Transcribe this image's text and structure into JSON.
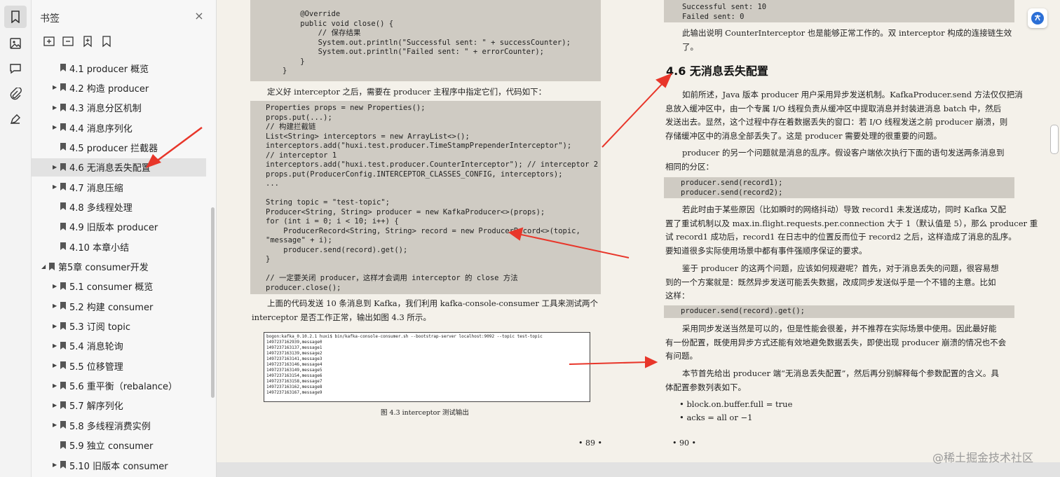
{
  "panel": {
    "title": "书签",
    "close": "×",
    "items": [
      {
        "label": "4.1 producer 概览",
        "level": 2,
        "caret": false
      },
      {
        "label": "4.2 构造 producer",
        "level": 2,
        "caret": true
      },
      {
        "label": "4.3 消息分区机制",
        "level": 2,
        "caret": true
      },
      {
        "label": "4.4 消息序列化",
        "level": 2,
        "caret": true
      },
      {
        "label": "4.5 producer 拦截器",
        "level": 2,
        "caret": false
      },
      {
        "label": "4.6 无消息丢失配置",
        "level": 2,
        "caret": true,
        "selected": true
      },
      {
        "label": "4.7 消息压缩",
        "level": 2,
        "caret": true
      },
      {
        "label": "4.8 多线程处理",
        "level": 2,
        "caret": false
      },
      {
        "label": "4.9 旧版本 producer",
        "level": 2,
        "caret": false
      },
      {
        "label": "4.10 本章小结",
        "level": 2,
        "caret": false
      },
      {
        "label": "第5章   consumer开发",
        "level": 1,
        "caret": true,
        "expanded": true
      },
      {
        "label": "5.1 consumer 概览",
        "level": 2,
        "caret": true
      },
      {
        "label": "5.2 构建 consumer",
        "level": 2,
        "caret": true
      },
      {
        "label": "5.3 订阅 topic",
        "level": 2,
        "caret": true
      },
      {
        "label": "5.4 消息轮询",
        "level": 2,
        "caret": true
      },
      {
        "label": "5.5 位移管理",
        "level": 2,
        "caret": true
      },
      {
        "label": "5.6 重平衡（rebalance）",
        "level": 2,
        "caret": true
      },
      {
        "label": "5.7 解序列化",
        "level": 2,
        "caret": true
      },
      {
        "label": "5.8 多线程消费实例",
        "level": 2,
        "caret": true
      },
      {
        "label": "5.9 独立 consumer",
        "level": 2,
        "caret": false
      },
      {
        "label": "5.10 旧版本 consumer",
        "level": 2,
        "caret": true
      }
    ]
  },
  "left_page": {
    "code1": "    @Override\n    public void close() {\n        // 保存结果\n        System.out.println(\"Successful sent: \" + successCounter);\n        System.out.println(\"Failed sent: \" + errorCounter);\n    }\n}",
    "para1": "定义好 interceptor 之后，需要在 producer 主程序中指定它们，代码如下：",
    "code2": "Properties props = new Properties();\nprops.put(...);\n// 构建拦截链\nList<String> interceptors = new ArrayList<>();\ninterceptors.add(\"huxi.test.producer.TimeStampPrependerInterceptor\");\n// interceptor 1\ninterceptors.add(\"huxi.test.producer.CounterInterceptor\"); // interceptor 2\nprops.put(ProducerConfig.INTERCEPTOR_CLASSES_CONFIG, interceptors);\n...\n\nString topic = \"test-topic\";\nProducer<String, String> producer = new KafkaProducer<>(props);\nfor (int i = 0; i < 10; i++) {\n    ProducerRecord<String, String> record = new ProducerRecord<>(topic,\n\"message\" + i);\n    producer.send(record).get();\n}\n\n// 一定要关闭 producer，这样才会调用 interceptor 的 close 方法\nproducer.close();",
    "para2a": "上面的代码发送 10 条消息到 Kafka，我们利用 kafka-console-consumer 工具来测试两个",
    "para2b": "interceptor 是否工作正常，输出如图 4.3 所示。",
    "terminal": "bogon:kafka_0.10.2.1 huxi$ bin/kafka-console-consumer.sh --bootstrap-server localhost:9092 --topic test-topic\n1497237162939,message0\n1497237163137,message1\n1497237163139,message2\n1497237163141,message3\n1497237163146,message4\n1497237163149,message5\n1497237163154,message6\n1497237163158,message7\n1497237163162,message8\n1497237163167,message9",
    "figure_caption": "图 4.3    interceptor 测试输出",
    "page_number": "• 89 •"
  },
  "right_page": {
    "code_top": "Successful sent: 10\nFailed sent: 0",
    "para_intro": "此输出说明 CounterInterceptor 也是能够正常工作的。双 interceptor 构成的连接链生效了。",
    "heading": "4.6   无消息丢失配置",
    "p1": [
      "如前所述，Java 版本 producer 用户采用异步发送机制。KafkaProducer.send 方法仅仅把消",
      "息放入缓冲区中，由一个专属 I/O 线程负责从缓冲区中提取消息并封装进消息 batch 中，然后",
      "发送出去。显然，这个过程中存在着数据丢失的窗口：若 I/O 线程发送之前 producer 崩溃，则",
      "存储缓冲区中的消息全部丢失了。这是 producer 需要处理的很重要的问题。"
    ],
    "p2": [
      "producer 的另一个问题就是消息的乱序。假设客户端依次执行下面的语句发送两条消息到",
      "相同的分区："
    ],
    "code_a": "producer.send(record1);\nproducer.send(record2);",
    "p3": [
      "若此时由于某些原因（比如瞬时的网络抖动）导致 record1 未发送成功，同时 Kafka 又配",
      "置了重试机制以及 max.in.flight.requests.per.connection 大于 1（默认值是 5），那么 producer 重",
      "试 record1 成功后，record1 在日志中的位置反而位于 record2 之后，这样造成了消息的乱序。",
      "要知道很多实际使用场景中都有事件强顺序保证的要求。"
    ],
    "p4": [
      "鉴于 producer 的这两个问题，应该如何规避呢？首先，对于消息丢失的问题，很容易想",
      "到的一个方案就是：既然异步发送可能丢失数据，改成同步发送似乎是一个不错的主意。比如",
      "这样："
    ],
    "code_b": "producer.send(record).get();",
    "p5": [
      "采用同步发送当然是可以的，但是性能会很差，并不推荐在实际场景中使用。因此最好能",
      "有一份配置，既使用异步方式还能有效地避免数据丢失，即使出现 producer 崩溃的情况也不会",
      "有问题。"
    ],
    "p6": [
      "本节首先给出 producer 端“无消息丢失配置”，然后再分别解释每个参数配置的含义。具",
      "体配置参数列表如下。"
    ],
    "bullets": [
      "block.on.buffer.full = true",
      "acks = all or −1"
    ],
    "page_number": "• 90 •"
  },
  "watermark": "@稀土掘金技术社区",
  "colors": {
    "arrow": "#e8362a",
    "code_bg": "#cfcbc3",
    "page_bg": "#f4f1ea"
  }
}
